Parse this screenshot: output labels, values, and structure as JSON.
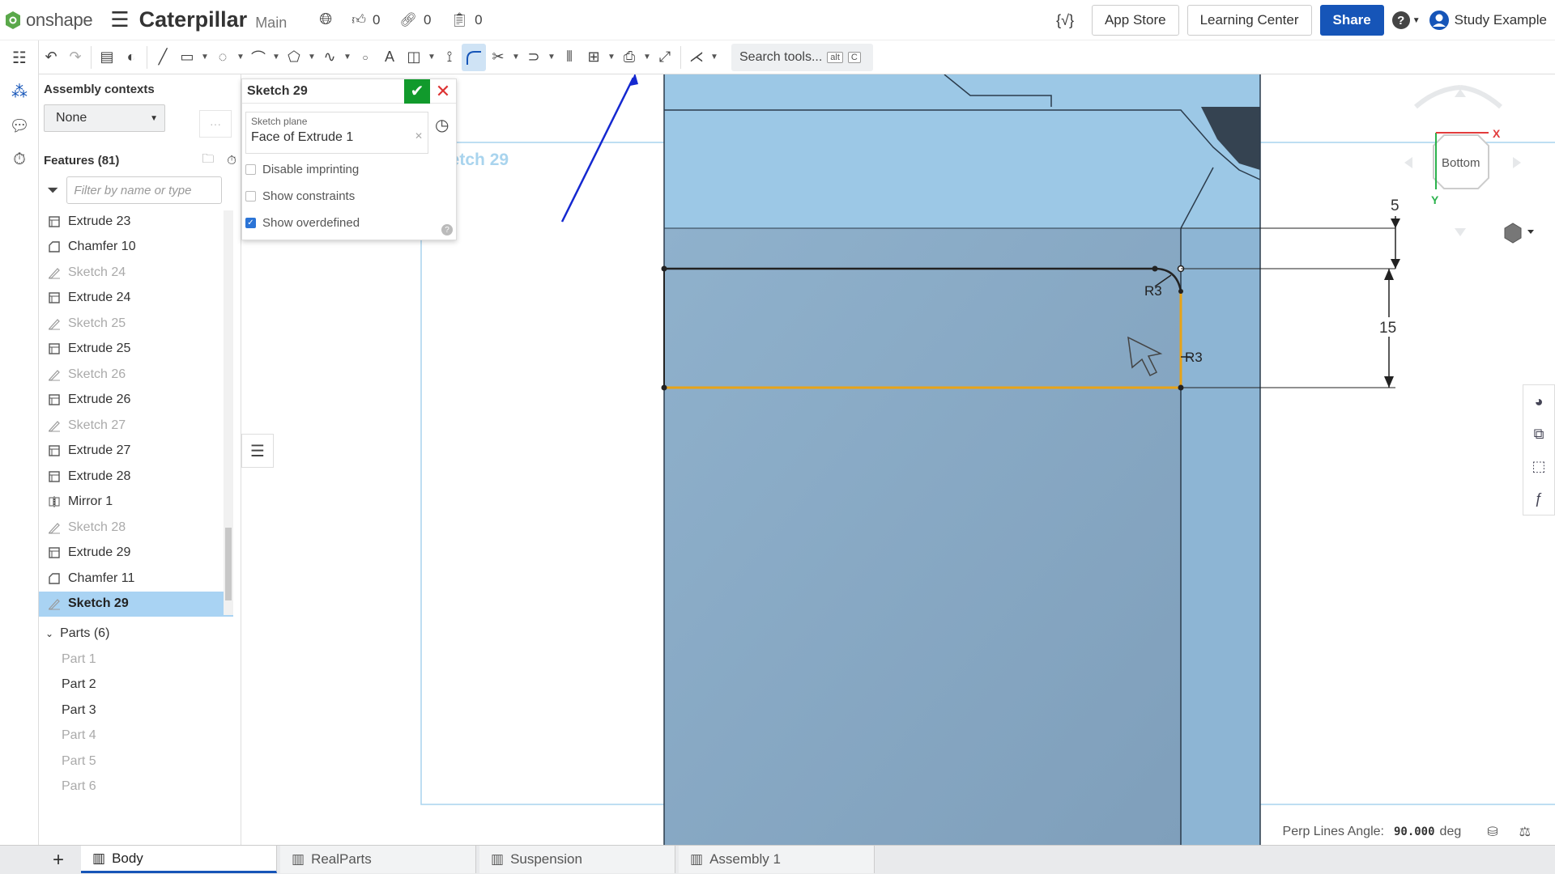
{
  "app": {
    "logo_text": "onshape",
    "doc_title": "Caterpillar",
    "branch": "Main"
  },
  "meta": {
    "likes": "0",
    "links": "0",
    "copies": "0"
  },
  "topright": {
    "variable_icon": "{√}",
    "app_store": "App Store",
    "learning_center": "Learning Center",
    "share": "Share",
    "help": "?",
    "user": "Study Example"
  },
  "toolbar": {
    "search_label": "Search tools...",
    "kbd_alt": "alt",
    "kbd_c": "C"
  },
  "assembly": {
    "title": "Assembly contexts",
    "selected": "None",
    "more": "···"
  },
  "features": {
    "title": "Features (81)",
    "filter_placeholder": "Filter by name or type",
    "items": [
      {
        "label": "Extrude 23",
        "type": "extrude",
        "dim": false,
        "selected": false
      },
      {
        "label": "Chamfer 10",
        "type": "chamfer",
        "dim": false,
        "selected": false
      },
      {
        "label": "Sketch 24",
        "type": "sketch",
        "dim": true,
        "selected": false
      },
      {
        "label": "Extrude 24",
        "type": "extrude",
        "dim": false,
        "selected": false
      },
      {
        "label": "Sketch 25",
        "type": "sketch",
        "dim": true,
        "selected": false
      },
      {
        "label": "Extrude 25",
        "type": "extrude",
        "dim": false,
        "selected": false
      },
      {
        "label": "Sketch 26",
        "type": "sketch",
        "dim": true,
        "selected": false
      },
      {
        "label": "Extrude 26",
        "type": "extrude",
        "dim": false,
        "selected": false
      },
      {
        "label": "Sketch 27",
        "type": "sketch",
        "dim": true,
        "selected": false
      },
      {
        "label": "Extrude 27",
        "type": "extrude",
        "dim": false,
        "selected": false
      },
      {
        "label": "Extrude 28",
        "type": "extrude",
        "dim": false,
        "selected": false
      },
      {
        "label": "Mirror 1",
        "type": "mirror",
        "dim": false,
        "selected": false
      },
      {
        "label": "Sketch 28",
        "type": "sketch",
        "dim": true,
        "selected": false
      },
      {
        "label": "Extrude 29",
        "type": "extrude",
        "dim": false,
        "selected": false
      },
      {
        "label": "Chamfer 11",
        "type": "chamfer",
        "dim": false,
        "selected": false
      },
      {
        "label": "Sketch 29",
        "type": "sketch",
        "dim": false,
        "selected": true
      }
    ]
  },
  "parts": {
    "title": "Parts (6)",
    "items": [
      {
        "label": "Part 1",
        "dim": true
      },
      {
        "label": "Part 2",
        "dim": false
      },
      {
        "label": "Part 3",
        "dim": false
      },
      {
        "label": "Part 4",
        "dim": true
      },
      {
        "label": "Part 5",
        "dim": true
      },
      {
        "label": "Part 6",
        "dim": true
      }
    ]
  },
  "sketch_dialog": {
    "title": "Sketch 29",
    "plane_label": "Sketch plane",
    "plane_value": "Face of Extrude 1",
    "disable_imprinting": "Disable imprinting",
    "show_constraints": "Show constraints",
    "show_overdefined": "Show overdefined",
    "disable_imprinting_checked": false,
    "show_constraints_checked": false,
    "show_overdefined_checked": true
  },
  "viewport": {
    "sketch_label": "Sketch 29",
    "dim_5": "5",
    "dim_15": "15",
    "radius_1": "R3",
    "radius_2": "R3",
    "view_cube": "Bottom",
    "axis_x": "X",
    "axis_y": "Y"
  },
  "status": {
    "label": "Perp Lines Angle:",
    "value": "90.000",
    "unit": "deg"
  },
  "tabs": [
    {
      "label": "Body",
      "active": true
    },
    {
      "label": "RealParts",
      "active": false
    },
    {
      "label": "Suspension",
      "active": false
    },
    {
      "label": "Assembly 1",
      "active": false
    }
  ],
  "colors": {
    "primary": "#1655b8",
    "ok": "#119a2c",
    "cancel": "#d33333",
    "selection": "#a9d3f3",
    "sketch_highlight": "#e8a317",
    "annotation_arrow": "#1428d0"
  }
}
